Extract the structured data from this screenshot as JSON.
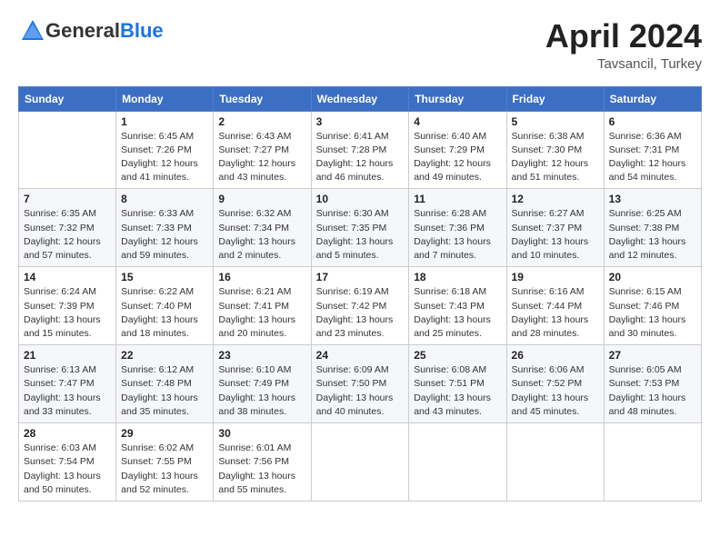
{
  "header": {
    "logo_general": "General",
    "logo_blue": "Blue",
    "month_year": "April 2024",
    "location": "Tavsancil, Turkey"
  },
  "weekdays": [
    "Sunday",
    "Monday",
    "Tuesday",
    "Wednesday",
    "Thursday",
    "Friday",
    "Saturday"
  ],
  "weeks": [
    [
      {
        "day": "",
        "sunrise": "",
        "sunset": "",
        "daylight": ""
      },
      {
        "day": "1",
        "sunrise": "Sunrise: 6:45 AM",
        "sunset": "Sunset: 7:26 PM",
        "daylight": "Daylight: 12 hours and 41 minutes."
      },
      {
        "day": "2",
        "sunrise": "Sunrise: 6:43 AM",
        "sunset": "Sunset: 7:27 PM",
        "daylight": "Daylight: 12 hours and 43 minutes."
      },
      {
        "day": "3",
        "sunrise": "Sunrise: 6:41 AM",
        "sunset": "Sunset: 7:28 PM",
        "daylight": "Daylight: 12 hours and 46 minutes."
      },
      {
        "day": "4",
        "sunrise": "Sunrise: 6:40 AM",
        "sunset": "Sunset: 7:29 PM",
        "daylight": "Daylight: 12 hours and 49 minutes."
      },
      {
        "day": "5",
        "sunrise": "Sunrise: 6:38 AM",
        "sunset": "Sunset: 7:30 PM",
        "daylight": "Daylight: 12 hours and 51 minutes."
      },
      {
        "day": "6",
        "sunrise": "Sunrise: 6:36 AM",
        "sunset": "Sunset: 7:31 PM",
        "daylight": "Daylight: 12 hours and 54 minutes."
      }
    ],
    [
      {
        "day": "7",
        "sunrise": "Sunrise: 6:35 AM",
        "sunset": "Sunset: 7:32 PM",
        "daylight": "Daylight: 12 hours and 57 minutes."
      },
      {
        "day": "8",
        "sunrise": "Sunrise: 6:33 AM",
        "sunset": "Sunset: 7:33 PM",
        "daylight": "Daylight: 12 hours and 59 minutes."
      },
      {
        "day": "9",
        "sunrise": "Sunrise: 6:32 AM",
        "sunset": "Sunset: 7:34 PM",
        "daylight": "Daylight: 13 hours and 2 minutes."
      },
      {
        "day": "10",
        "sunrise": "Sunrise: 6:30 AM",
        "sunset": "Sunset: 7:35 PM",
        "daylight": "Daylight: 13 hours and 5 minutes."
      },
      {
        "day": "11",
        "sunrise": "Sunrise: 6:28 AM",
        "sunset": "Sunset: 7:36 PM",
        "daylight": "Daylight: 13 hours and 7 minutes."
      },
      {
        "day": "12",
        "sunrise": "Sunrise: 6:27 AM",
        "sunset": "Sunset: 7:37 PM",
        "daylight": "Daylight: 13 hours and 10 minutes."
      },
      {
        "day": "13",
        "sunrise": "Sunrise: 6:25 AM",
        "sunset": "Sunset: 7:38 PM",
        "daylight": "Daylight: 13 hours and 12 minutes."
      }
    ],
    [
      {
        "day": "14",
        "sunrise": "Sunrise: 6:24 AM",
        "sunset": "Sunset: 7:39 PM",
        "daylight": "Daylight: 13 hours and 15 minutes."
      },
      {
        "day": "15",
        "sunrise": "Sunrise: 6:22 AM",
        "sunset": "Sunset: 7:40 PM",
        "daylight": "Daylight: 13 hours and 18 minutes."
      },
      {
        "day": "16",
        "sunrise": "Sunrise: 6:21 AM",
        "sunset": "Sunset: 7:41 PM",
        "daylight": "Daylight: 13 hours and 20 minutes."
      },
      {
        "day": "17",
        "sunrise": "Sunrise: 6:19 AM",
        "sunset": "Sunset: 7:42 PM",
        "daylight": "Daylight: 13 hours and 23 minutes."
      },
      {
        "day": "18",
        "sunrise": "Sunrise: 6:18 AM",
        "sunset": "Sunset: 7:43 PM",
        "daylight": "Daylight: 13 hours and 25 minutes."
      },
      {
        "day": "19",
        "sunrise": "Sunrise: 6:16 AM",
        "sunset": "Sunset: 7:44 PM",
        "daylight": "Daylight: 13 hours and 28 minutes."
      },
      {
        "day": "20",
        "sunrise": "Sunrise: 6:15 AM",
        "sunset": "Sunset: 7:46 PM",
        "daylight": "Daylight: 13 hours and 30 minutes."
      }
    ],
    [
      {
        "day": "21",
        "sunrise": "Sunrise: 6:13 AM",
        "sunset": "Sunset: 7:47 PM",
        "daylight": "Daylight: 13 hours and 33 minutes."
      },
      {
        "day": "22",
        "sunrise": "Sunrise: 6:12 AM",
        "sunset": "Sunset: 7:48 PM",
        "daylight": "Daylight: 13 hours and 35 minutes."
      },
      {
        "day": "23",
        "sunrise": "Sunrise: 6:10 AM",
        "sunset": "Sunset: 7:49 PM",
        "daylight": "Daylight: 13 hours and 38 minutes."
      },
      {
        "day": "24",
        "sunrise": "Sunrise: 6:09 AM",
        "sunset": "Sunset: 7:50 PM",
        "daylight": "Daylight: 13 hours and 40 minutes."
      },
      {
        "day": "25",
        "sunrise": "Sunrise: 6:08 AM",
        "sunset": "Sunset: 7:51 PM",
        "daylight": "Daylight: 13 hours and 43 minutes."
      },
      {
        "day": "26",
        "sunrise": "Sunrise: 6:06 AM",
        "sunset": "Sunset: 7:52 PM",
        "daylight": "Daylight: 13 hours and 45 minutes."
      },
      {
        "day": "27",
        "sunrise": "Sunrise: 6:05 AM",
        "sunset": "Sunset: 7:53 PM",
        "daylight": "Daylight: 13 hours and 48 minutes."
      }
    ],
    [
      {
        "day": "28",
        "sunrise": "Sunrise: 6:03 AM",
        "sunset": "Sunset: 7:54 PM",
        "daylight": "Daylight: 13 hours and 50 minutes."
      },
      {
        "day": "29",
        "sunrise": "Sunrise: 6:02 AM",
        "sunset": "Sunset: 7:55 PM",
        "daylight": "Daylight: 13 hours and 52 minutes."
      },
      {
        "day": "30",
        "sunrise": "Sunrise: 6:01 AM",
        "sunset": "Sunset: 7:56 PM",
        "daylight": "Daylight: 13 hours and 55 minutes."
      },
      {
        "day": "",
        "sunrise": "",
        "sunset": "",
        "daylight": ""
      },
      {
        "day": "",
        "sunrise": "",
        "sunset": "",
        "daylight": ""
      },
      {
        "day": "",
        "sunrise": "",
        "sunset": "",
        "daylight": ""
      },
      {
        "day": "",
        "sunrise": "",
        "sunset": "",
        "daylight": ""
      }
    ]
  ]
}
